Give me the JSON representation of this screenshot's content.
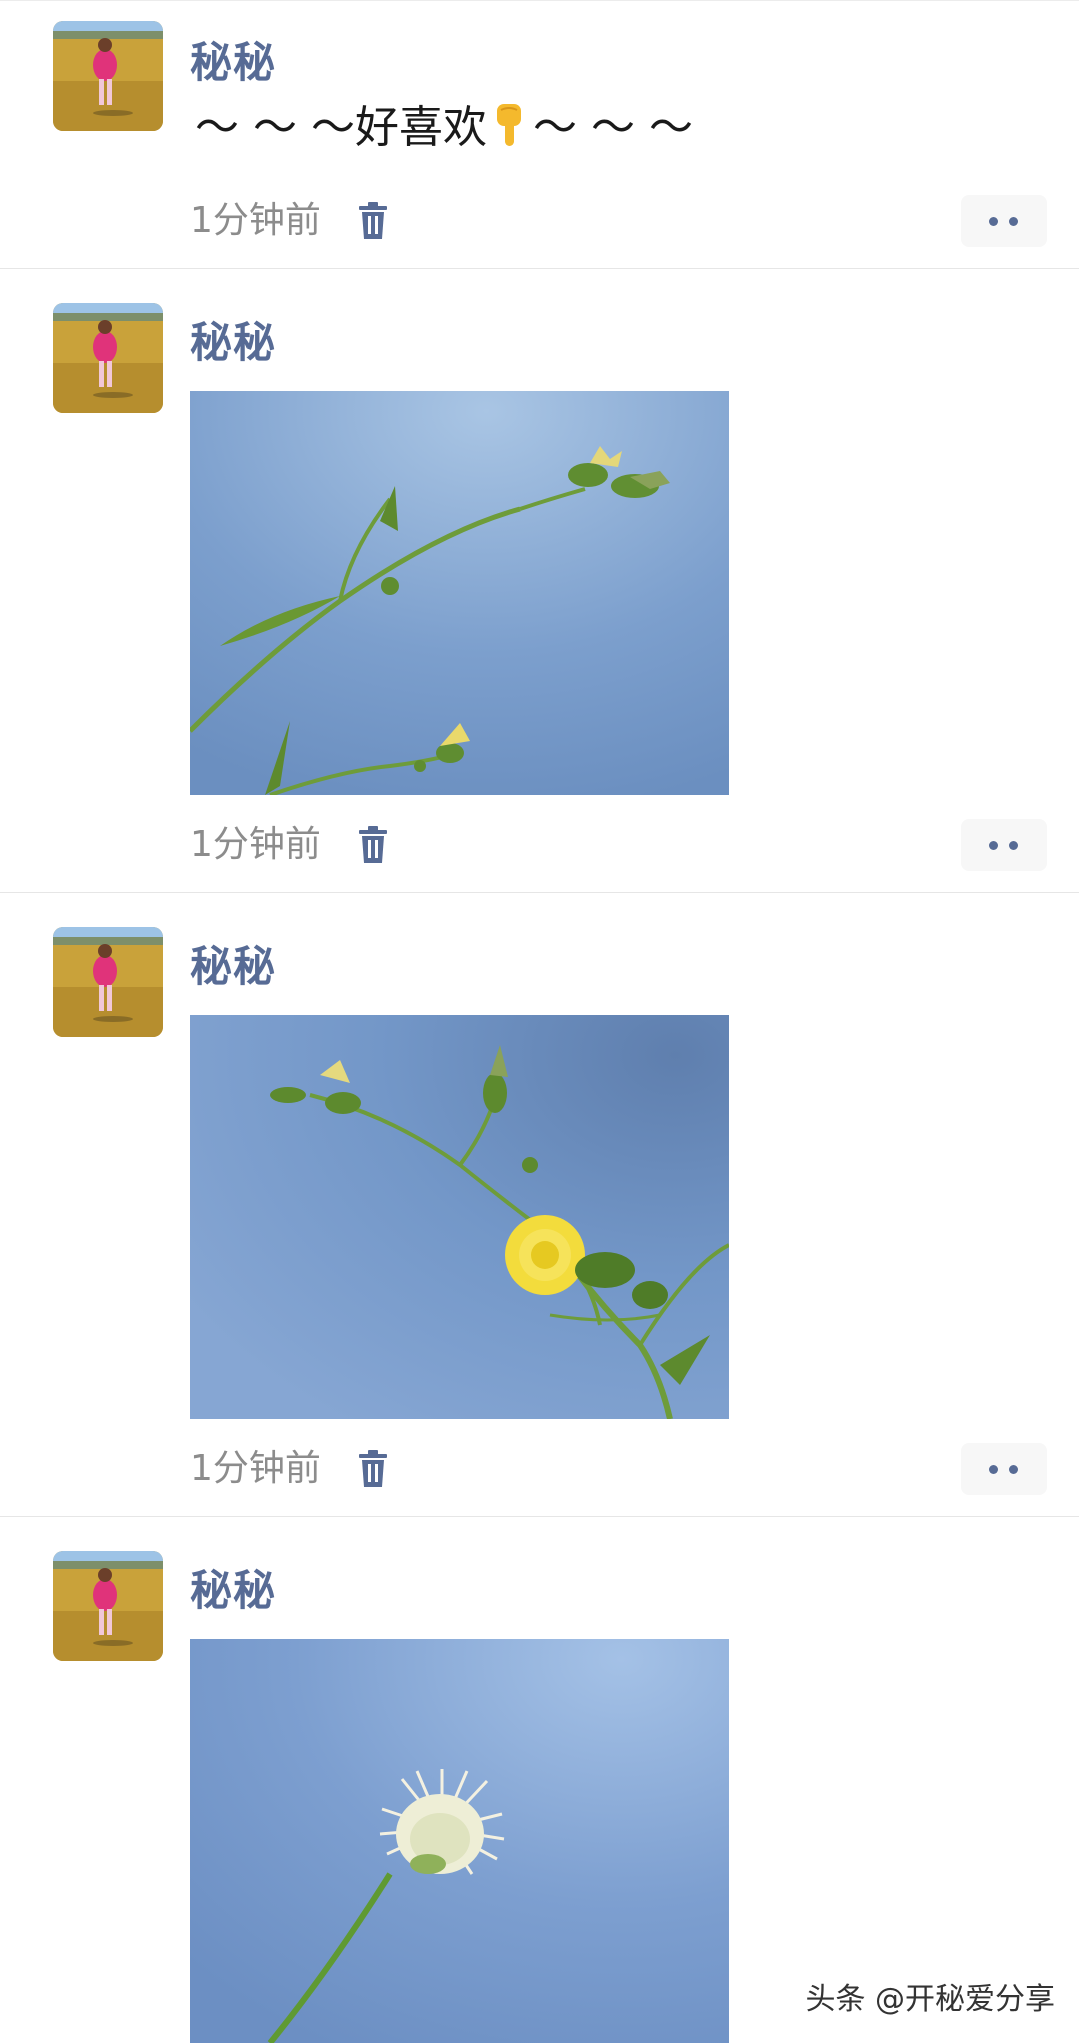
{
  "posts": [
    {
      "nickname": "秘秘",
      "text_before": "～ ～ ～好喜欢",
      "emoji": "pointing-down-hand-icon",
      "text_after": "～ ～ ～",
      "time": "1分钟前",
      "photo": null
    },
    {
      "nickname": "秘秘",
      "time": "1分钟前",
      "photo": "flower-buds-on-stem-blue-sky"
    },
    {
      "nickname": "秘秘",
      "time": "1分钟前",
      "photo": "yellow-dandelion-flower-blue-sky"
    },
    {
      "nickname": "秘秘",
      "photo": "white-seed-head-blue-sky"
    }
  ],
  "watermark": "头条 @开秘爱分享",
  "colors": {
    "nickname": "#576b95",
    "time": "#8c8c8c",
    "sky": "#7a9ccb",
    "background": "#ffffff"
  }
}
